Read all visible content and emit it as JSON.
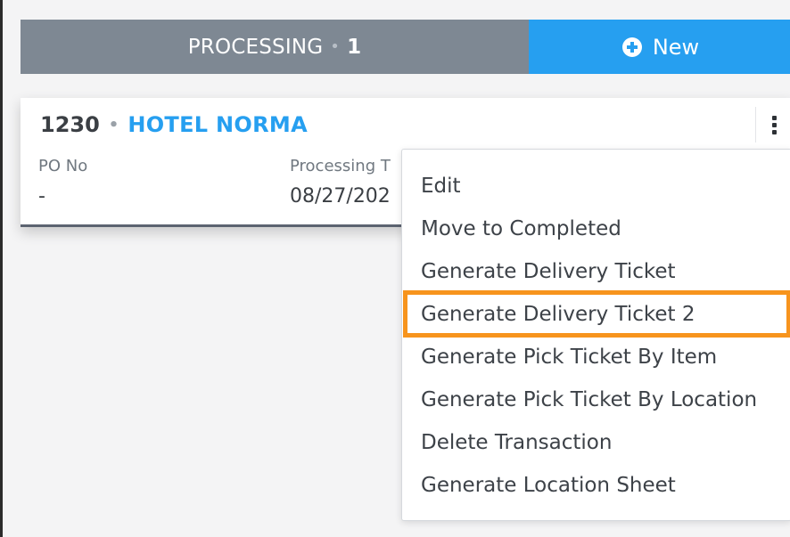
{
  "topbar": {
    "status_label": "PROCESSING",
    "status_separator": "•",
    "status_count": "1",
    "new_label": "New"
  },
  "card": {
    "id": "1230",
    "separator": "•",
    "customer": "HOTEL NORMA",
    "po_label": "PO No",
    "po_value": "-",
    "processing_label": "Processing T",
    "processing_value": "08/27/202"
  },
  "menu": {
    "items": [
      "Edit",
      "Move to Completed",
      "Generate Delivery Ticket",
      "Generate Delivery Ticket 2",
      "Generate Pick Ticket By Item",
      "Generate Pick Ticket By Location",
      "Delete Transaction",
      "Generate Location Sheet"
    ],
    "highlighted_index": 3
  },
  "colors": {
    "accent": "#269ff0",
    "status_bar": "#7e8893",
    "highlight": "#f7941d"
  }
}
